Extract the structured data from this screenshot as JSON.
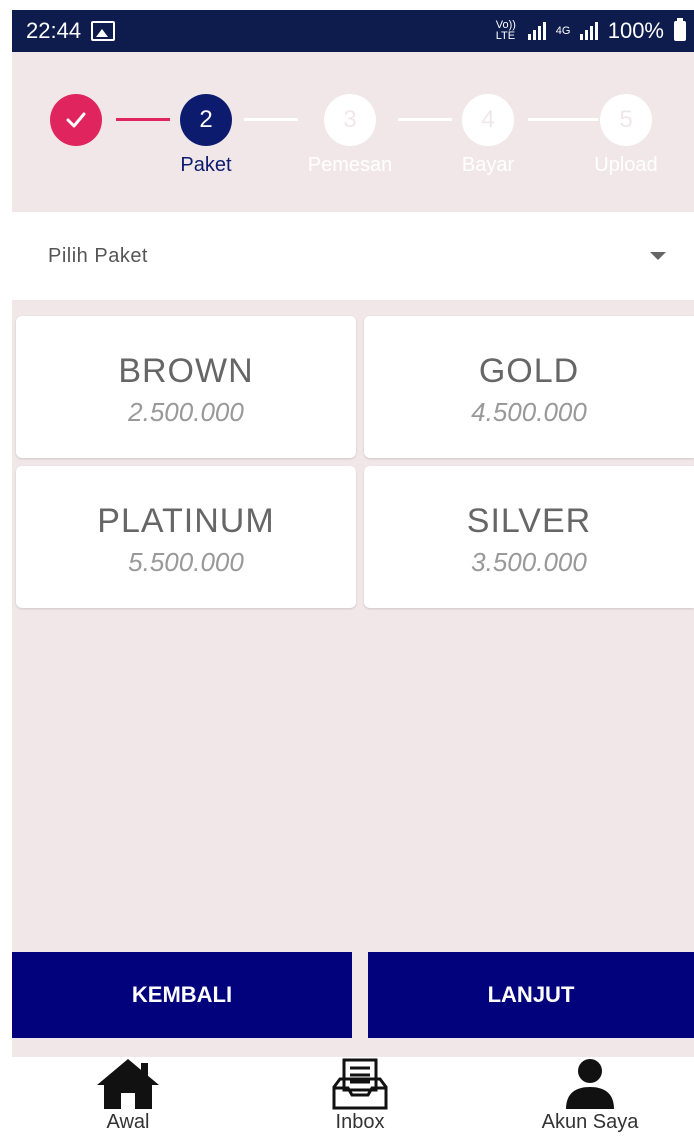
{
  "status_bar": {
    "time": "22:44",
    "network_label": "Vo)) LTE",
    "network2_label": "4G",
    "battery": "100%"
  },
  "stepper": {
    "steps": [
      {
        "number": "1",
        "label": "",
        "state": "done"
      },
      {
        "number": "2",
        "label": "Paket",
        "state": "active"
      },
      {
        "number": "3",
        "label": "Pemesan",
        "state": "pending"
      },
      {
        "number": "4",
        "label": "Bayar",
        "state": "pending"
      },
      {
        "number": "5",
        "label": "Upload",
        "state": "pending"
      }
    ],
    "colors": {
      "done": "#e0245e",
      "active": "#0d1b6e",
      "pending": "#ffffff"
    }
  },
  "package_select": {
    "value": "Pilih Paket"
  },
  "packages": [
    {
      "name": "BROWN",
      "price": "2.500.000"
    },
    {
      "name": "GOLD",
      "price": "4.500.000"
    },
    {
      "name": "PLATINUM",
      "price": "5.500.000"
    },
    {
      "name": "SILVER",
      "price": "3.500.000"
    }
  ],
  "actions": {
    "back_label": "KEMBALI",
    "next_label": "LANJUT",
    "color": "#02027c"
  },
  "bottom_nav": {
    "items": [
      {
        "label": "Awal",
        "icon": "home-icon"
      },
      {
        "label": "Inbox",
        "icon": "inbox-icon"
      },
      {
        "label": "Akun Saya",
        "icon": "user-icon"
      }
    ]
  }
}
